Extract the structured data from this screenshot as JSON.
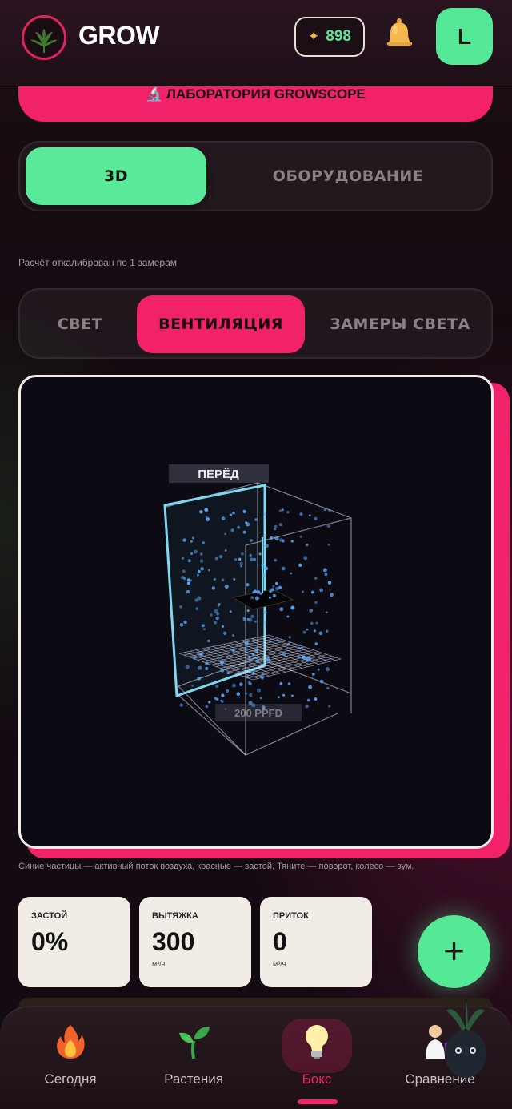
{
  "header": {
    "logo_text": "GROW",
    "logo_icon": "cannabis-leaf-icon",
    "coins": "898",
    "coin_icon": "sparkle-icon",
    "bell_icon": "bell-icon",
    "avatar_letter": "L"
  },
  "lab_banner": {
    "label": "🔬 ЛАБОРАТОРИЯ GROWSCOPE"
  },
  "view_tabs": [
    {
      "label": "3D",
      "active": true
    },
    {
      "label": "ОБОРУДОВАНИЕ",
      "active": false
    }
  ],
  "calibration_note": "Расчёт откалиброван по 1 замерам",
  "mode_tabs": [
    {
      "label": "СВЕТ",
      "active": false
    },
    {
      "label": "ВЕНТИЛЯЦИЯ",
      "active": true
    },
    {
      "label": "ЗАМЕРЫ СВЕТА",
      "active": false
    }
  ],
  "viewer": {
    "front_label": "ПЕРЁД",
    "ppfd_label": "200 PPFD"
  },
  "viewer_hint": "Синие частицы — активный поток воздуха, красные — застой. Тяните — поворот, колесо — зум.",
  "stats": [
    {
      "label": "ЗАСТОЙ",
      "value": "0%",
      "unit": ""
    },
    {
      "label": "ВЫТЯЖКА",
      "value": "300",
      "unit": "м³/ч"
    },
    {
      "label": "ПРИТОК",
      "value": "0",
      "unit": "м³/ч"
    }
  ],
  "fab": {
    "label": "+"
  },
  "nav": [
    {
      "label": "Сегодня",
      "icon": "fire-icon",
      "active": false
    },
    {
      "label": "Растения",
      "icon": "seedling-icon",
      "active": false
    },
    {
      "label": "Бокс",
      "icon": "lightbulb-icon",
      "active": true
    },
    {
      "label": "Сравнение",
      "icon": "scientist-icon",
      "active": false
    }
  ],
  "colors": {
    "accent_pink": "#f2226a",
    "accent_green": "#55e897",
    "card_bg": "#f1ede6",
    "particle_blue": "#5aa8ff"
  }
}
